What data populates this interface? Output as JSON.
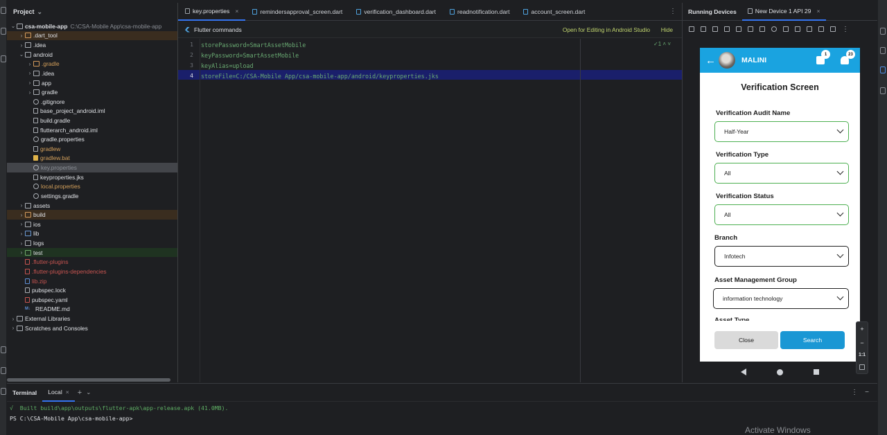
{
  "project": {
    "header": "Project",
    "tree": [
      {
        "label": "csa-mobile-app",
        "suffix": "C:\\CSA-Mobile App\\csa-mobile-app",
        "level": 0,
        "arrow": "⌄",
        "icon": "folder",
        "color": "t-white",
        "hl": ""
      },
      {
        "label": ".dart_tool",
        "level": 1,
        "arrow": "›",
        "icon": "folder-o",
        "color": "t-white",
        "hl": "hl-orange"
      },
      {
        "label": ".idea",
        "level": 1,
        "arrow": "›",
        "icon": "folder",
        "color": "t-white",
        "hl": ""
      },
      {
        "label": "android",
        "level": 1,
        "arrow": "⌄",
        "icon": "folder",
        "color": "t-white",
        "hl": ""
      },
      {
        "label": ".gradle",
        "level": 2,
        "arrow": "›",
        "icon": "folder-o",
        "color": "t-orange",
        "hl": ""
      },
      {
        "label": ".idea",
        "level": 2,
        "arrow": "›",
        "icon": "folder",
        "color": "t-white",
        "hl": ""
      },
      {
        "label": "app",
        "level": 2,
        "arrow": "›",
        "icon": "folder",
        "color": "t-white",
        "hl": ""
      },
      {
        "label": "gradle",
        "level": 2,
        "arrow": "›",
        "icon": "folder",
        "color": "t-white",
        "hl": ""
      },
      {
        "label": ".gitignore",
        "level": 2,
        "arrow": "",
        "icon": "gear",
        "color": "t-white",
        "hl": ""
      },
      {
        "label": "base_project_android.iml",
        "level": 2,
        "arrow": "",
        "icon": "file",
        "color": "t-white",
        "hl": ""
      },
      {
        "label": "build.gradle",
        "level": 2,
        "arrow": "",
        "icon": "file",
        "color": "t-white",
        "hl": ""
      },
      {
        "label": "flutterarch_android.iml",
        "level": 2,
        "arrow": "",
        "icon": "file",
        "color": "t-white",
        "hl": ""
      },
      {
        "label": "gradle.properties",
        "level": 2,
        "arrow": "",
        "icon": "gear",
        "color": "t-white",
        "hl": ""
      },
      {
        "label": "gradlew",
        "level": 2,
        "arrow": "",
        "icon": "file",
        "color": "t-orange",
        "hl": ""
      },
      {
        "label": "gradlew.bat",
        "level": 2,
        "arrow": "",
        "icon": "file yellow",
        "color": "t-orange",
        "hl": ""
      },
      {
        "label": "key.properties",
        "level": 2,
        "arrow": "",
        "icon": "gear",
        "color": "t-grey",
        "hl": "hl-sel"
      },
      {
        "label": "keyproperties.jks",
        "level": 2,
        "arrow": "",
        "icon": "file",
        "color": "t-white",
        "hl": ""
      },
      {
        "label": "local.properties",
        "level": 2,
        "arrow": "",
        "icon": "gear",
        "color": "t-orange",
        "hl": ""
      },
      {
        "label": "settings.gradle",
        "level": 2,
        "arrow": "",
        "icon": "gear",
        "color": "t-white",
        "hl": ""
      },
      {
        "label": "assets",
        "level": 1,
        "arrow": "›",
        "icon": "folder",
        "color": "t-white",
        "hl": ""
      },
      {
        "label": "build",
        "level": 1,
        "arrow": "›",
        "icon": "folder-o",
        "color": "t-white",
        "hl": "hl-orange"
      },
      {
        "label": "ios",
        "level": 1,
        "arrow": "›",
        "icon": "folder",
        "color": "t-white",
        "hl": ""
      },
      {
        "label": "lib",
        "level": 1,
        "arrow": "›",
        "icon": "folder-b",
        "color": "t-white",
        "hl": ""
      },
      {
        "label": "logs",
        "level": 1,
        "arrow": "›",
        "icon": "folder",
        "color": "t-white",
        "hl": ""
      },
      {
        "label": "test",
        "level": 1,
        "arrow": "›",
        "icon": "folder-g",
        "color": "t-white",
        "hl": "hl-green"
      },
      {
        "label": ".flutter-plugins",
        "level": 1,
        "arrow": "",
        "icon": "file red",
        "color": "t-red",
        "hl": ""
      },
      {
        "label": ".flutter-plugins-dependencies",
        "level": 1,
        "arrow": "",
        "icon": "file red",
        "color": "t-red",
        "hl": ""
      },
      {
        "label": "lib.zip",
        "level": 1,
        "arrow": "",
        "icon": "file blue",
        "color": "t-red",
        "hl": ""
      },
      {
        "label": "pubspec.lock",
        "level": 1,
        "arrow": "",
        "icon": "file",
        "color": "t-white",
        "hl": ""
      },
      {
        "label": "pubspec.yaml",
        "level": 1,
        "arrow": "",
        "icon": "file red",
        "color": "t-white",
        "hl": ""
      },
      {
        "label": "README.md",
        "level": 1,
        "arrow": "",
        "icon": "md",
        "color": "t-white",
        "hl": ""
      },
      {
        "label": "External Libraries",
        "level": 0,
        "arrow": "›",
        "icon": "folder",
        "color": "t-white",
        "hl": ""
      },
      {
        "label": "Scratches and Consoles",
        "level": 0,
        "arrow": "›",
        "icon": "folder",
        "color": "t-white",
        "hl": ""
      }
    ]
  },
  "editor": {
    "tabs": [
      {
        "label": "key.properties",
        "active": true,
        "closable": true
      },
      {
        "label": "remindersapproval_screen.dart",
        "active": false,
        "closable": false
      },
      {
        "label": "verification_dashboard.dart",
        "active": false,
        "closable": false
      },
      {
        "label": "readnotification.dart",
        "active": false,
        "closable": false
      },
      {
        "label": "account_screen.dart",
        "active": false,
        "closable": false
      }
    ],
    "flutter_bar_label": "Flutter commands",
    "open_android_label": "Open for Editing in Android Studio",
    "hide_label": "Hide",
    "inspection": "✓1 ˄ ˅",
    "lines": [
      {
        "num": "1",
        "text": "storePassword=SmartAssetMobile"
      },
      {
        "num": "2",
        "text": "keyPassword=SmartAssetMobile"
      },
      {
        "num": "3",
        "text": "keyAlias=upload"
      },
      {
        "num": "4",
        "text": "storeFile=C:/CSA-Mobile App/csa-mobile-app/android/keyproperties.jks"
      }
    ]
  },
  "devices": {
    "running_label": "Running Devices",
    "device_tab": "New Device 1 API 29",
    "app": {
      "user_name": "MALINI",
      "cart_badge": "1",
      "bell_badge": "23",
      "screen_title": "Verification Screen",
      "fields": [
        {
          "label": "Verification Audit Name",
          "value": "Half-Year"
        },
        {
          "label": "Verification Type",
          "value": "All"
        },
        {
          "label": "Verification Status",
          "value": "All"
        },
        {
          "label": "Branch",
          "value": "Infotech"
        },
        {
          "label": "Asset Management Group",
          "value": "information technology"
        },
        {
          "label": "Asset Type",
          "value": ""
        }
      ],
      "close_label": "Close",
      "search_label": "Search"
    },
    "zoom": {
      "plus": "+",
      "minus": "−",
      "ratio": "1:1"
    }
  },
  "terminal": {
    "title": "Terminal",
    "tab": "Local",
    "line1": "√  Built build\\app\\outputs\\flutter-apk\\app-release.apk (41.0MB).",
    "line2": "PS C:\\CSA-Mobile App\\csa-mobile-app>"
  },
  "watermark": "Activate Windows"
}
